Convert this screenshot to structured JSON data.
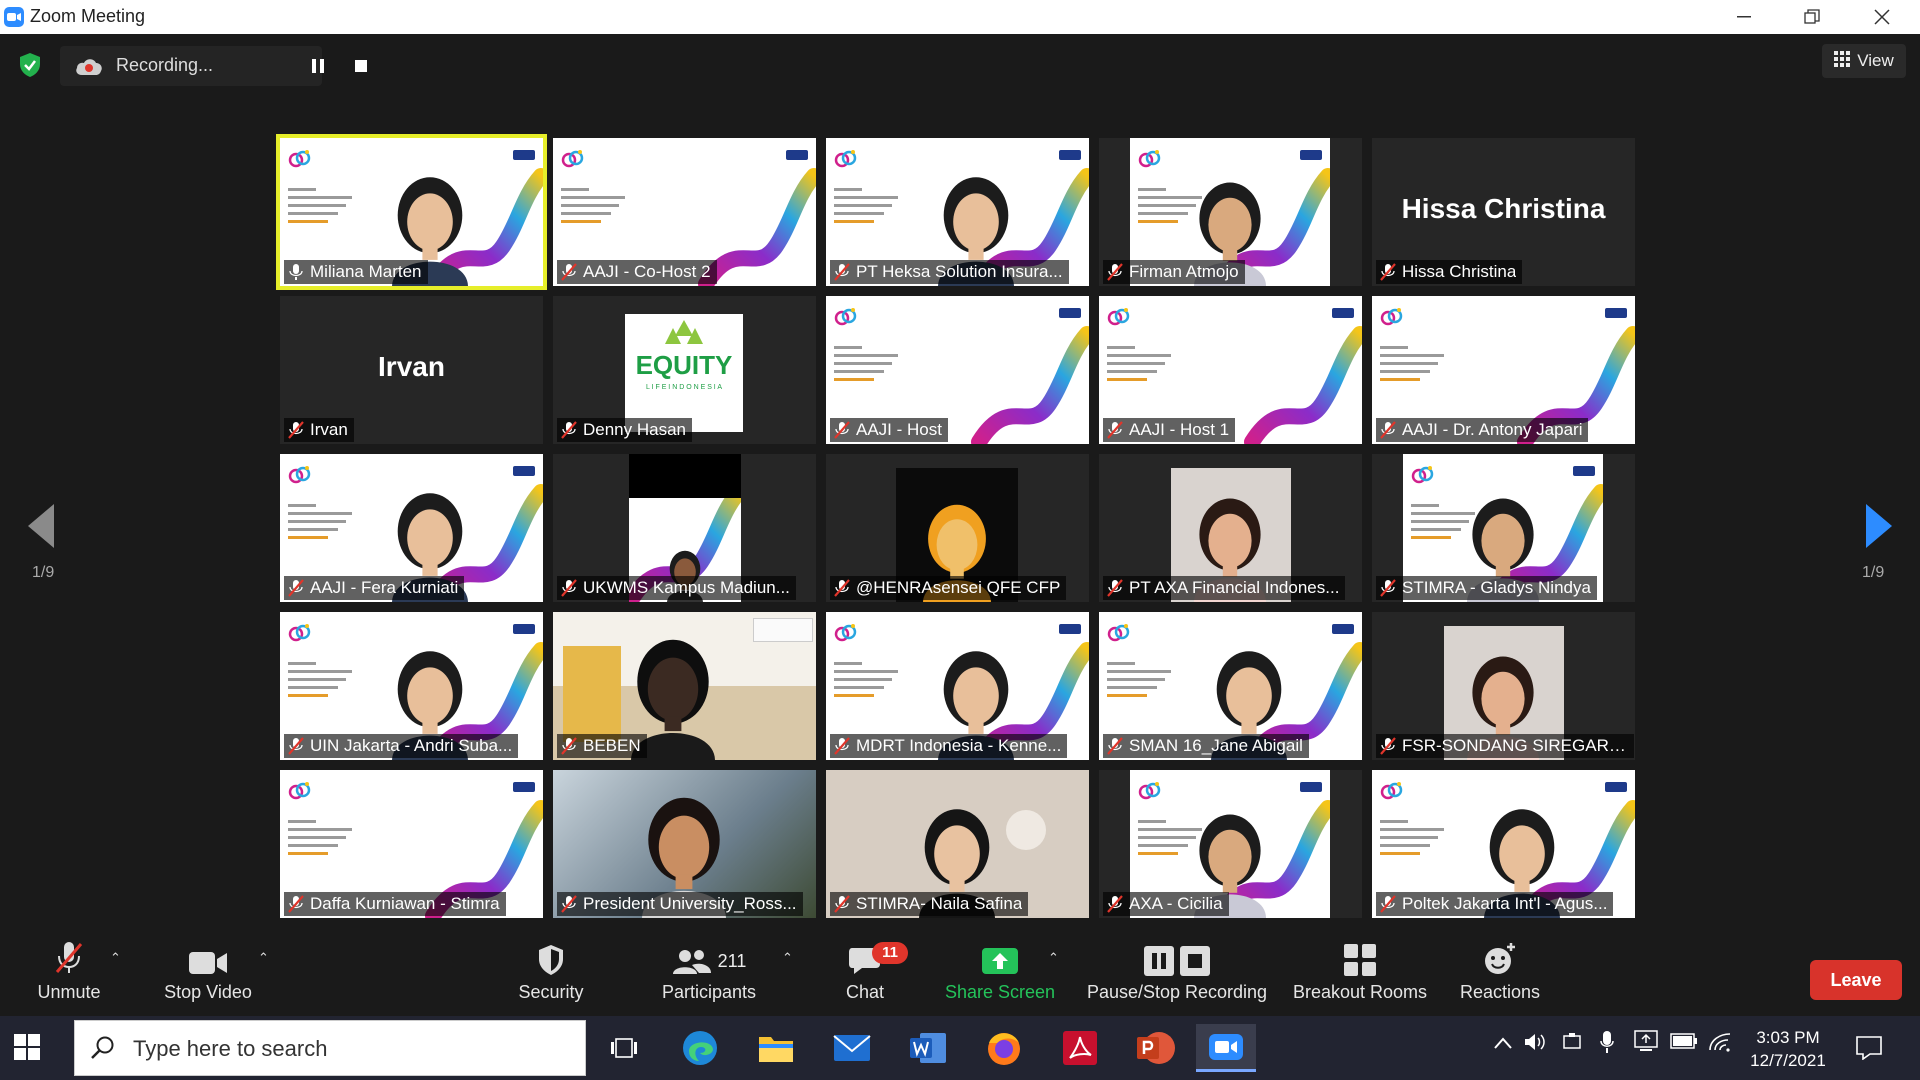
{
  "window": {
    "title": "Zoom Meeting"
  },
  "recording": {
    "label": "Recording..."
  },
  "view_button": {
    "label": "View"
  },
  "pagination": {
    "left": "1/9",
    "right": "1/9"
  },
  "tiles": [
    {
      "name": "Miliana Marten",
      "kind": "slide-person",
      "active": true,
      "mic": "speaking"
    },
    {
      "name": "AAJI - Co-Host 2",
      "kind": "slide"
    },
    {
      "name": "PT Heksa Solution Insura...",
      "kind": "slide-person"
    },
    {
      "name": "Firman Atmojo",
      "kind": "cam-slide"
    },
    {
      "name": "Hissa Christina",
      "kind": "text",
      "big": "Hissa Christina"
    },
    {
      "name": "Irvan",
      "kind": "text",
      "big": "Irvan"
    },
    {
      "name": "Denny Hasan",
      "kind": "equity",
      "logo": "EQUITY",
      "sub": "L I F E   I N D O N E S I A"
    },
    {
      "name": "AAJI - Host",
      "kind": "slide"
    },
    {
      "name": "AAJI - Host 1",
      "kind": "slide"
    },
    {
      "name": "AAJI - Dr. Antony Japari",
      "kind": "slide"
    },
    {
      "name": "AAJI - Fera Kurniati",
      "kind": "slide-person"
    },
    {
      "name": "UKWMS Kampus Madiun...",
      "kind": "small-slide"
    },
    {
      "name": "@HENRAsensei QFE CFP",
      "kind": "poster"
    },
    {
      "name": "PT AXA Financial Indones...",
      "kind": "cam-narrow"
    },
    {
      "name": "STIMRA - Gladys Nindya",
      "kind": "cam-slide"
    },
    {
      "name": "UIN Jakarta - Andri Suba...",
      "kind": "slide-person"
    },
    {
      "name": "BEBEN",
      "kind": "room"
    },
    {
      "name": "MDRT Indonesia - Kenne...",
      "kind": "slide-person"
    },
    {
      "name": "SMAN 16_Jane Abigail",
      "kind": "slide-person"
    },
    {
      "name": "FSR-SONDANG SIREGAR-...",
      "kind": "cam-narrow"
    },
    {
      "name": "Daffa Kurniawan - Stimra",
      "kind": "slide"
    },
    {
      "name": "President University_Ross...",
      "kind": "outdoor"
    },
    {
      "name": "STIMRA- Naila Safina",
      "kind": "room2"
    },
    {
      "name": "AXA - Cicilia",
      "kind": "cam-slide"
    },
    {
      "name": "Poltek Jakarta Int'l - Agus...",
      "kind": "slide-person"
    }
  ],
  "toolbar": {
    "unmute": "Unmute",
    "stop_video": "Stop Video",
    "security": "Security",
    "participants": "Participants",
    "participants_count": "211",
    "chat": "Chat",
    "chat_badge": "11",
    "share_screen": "Share Screen",
    "pause_stop_recording": "Pause/Stop Recording",
    "breakout_rooms": "Breakout Rooms",
    "reactions": "Reactions",
    "leave": "Leave"
  },
  "taskbar": {
    "search_placeholder": "Type here to search",
    "time": "3:03 PM",
    "date": "12/7/2021",
    "apps": [
      "task-view",
      "edge",
      "file-explorer",
      "mail",
      "word",
      "firefox",
      "acrobat",
      "powerpoint",
      "zoom"
    ]
  },
  "colors": {
    "active_speaker": "#e6ee2a",
    "leave": "#d8332b",
    "share_green": "#24c35a",
    "muted_red": "#e0352b"
  }
}
